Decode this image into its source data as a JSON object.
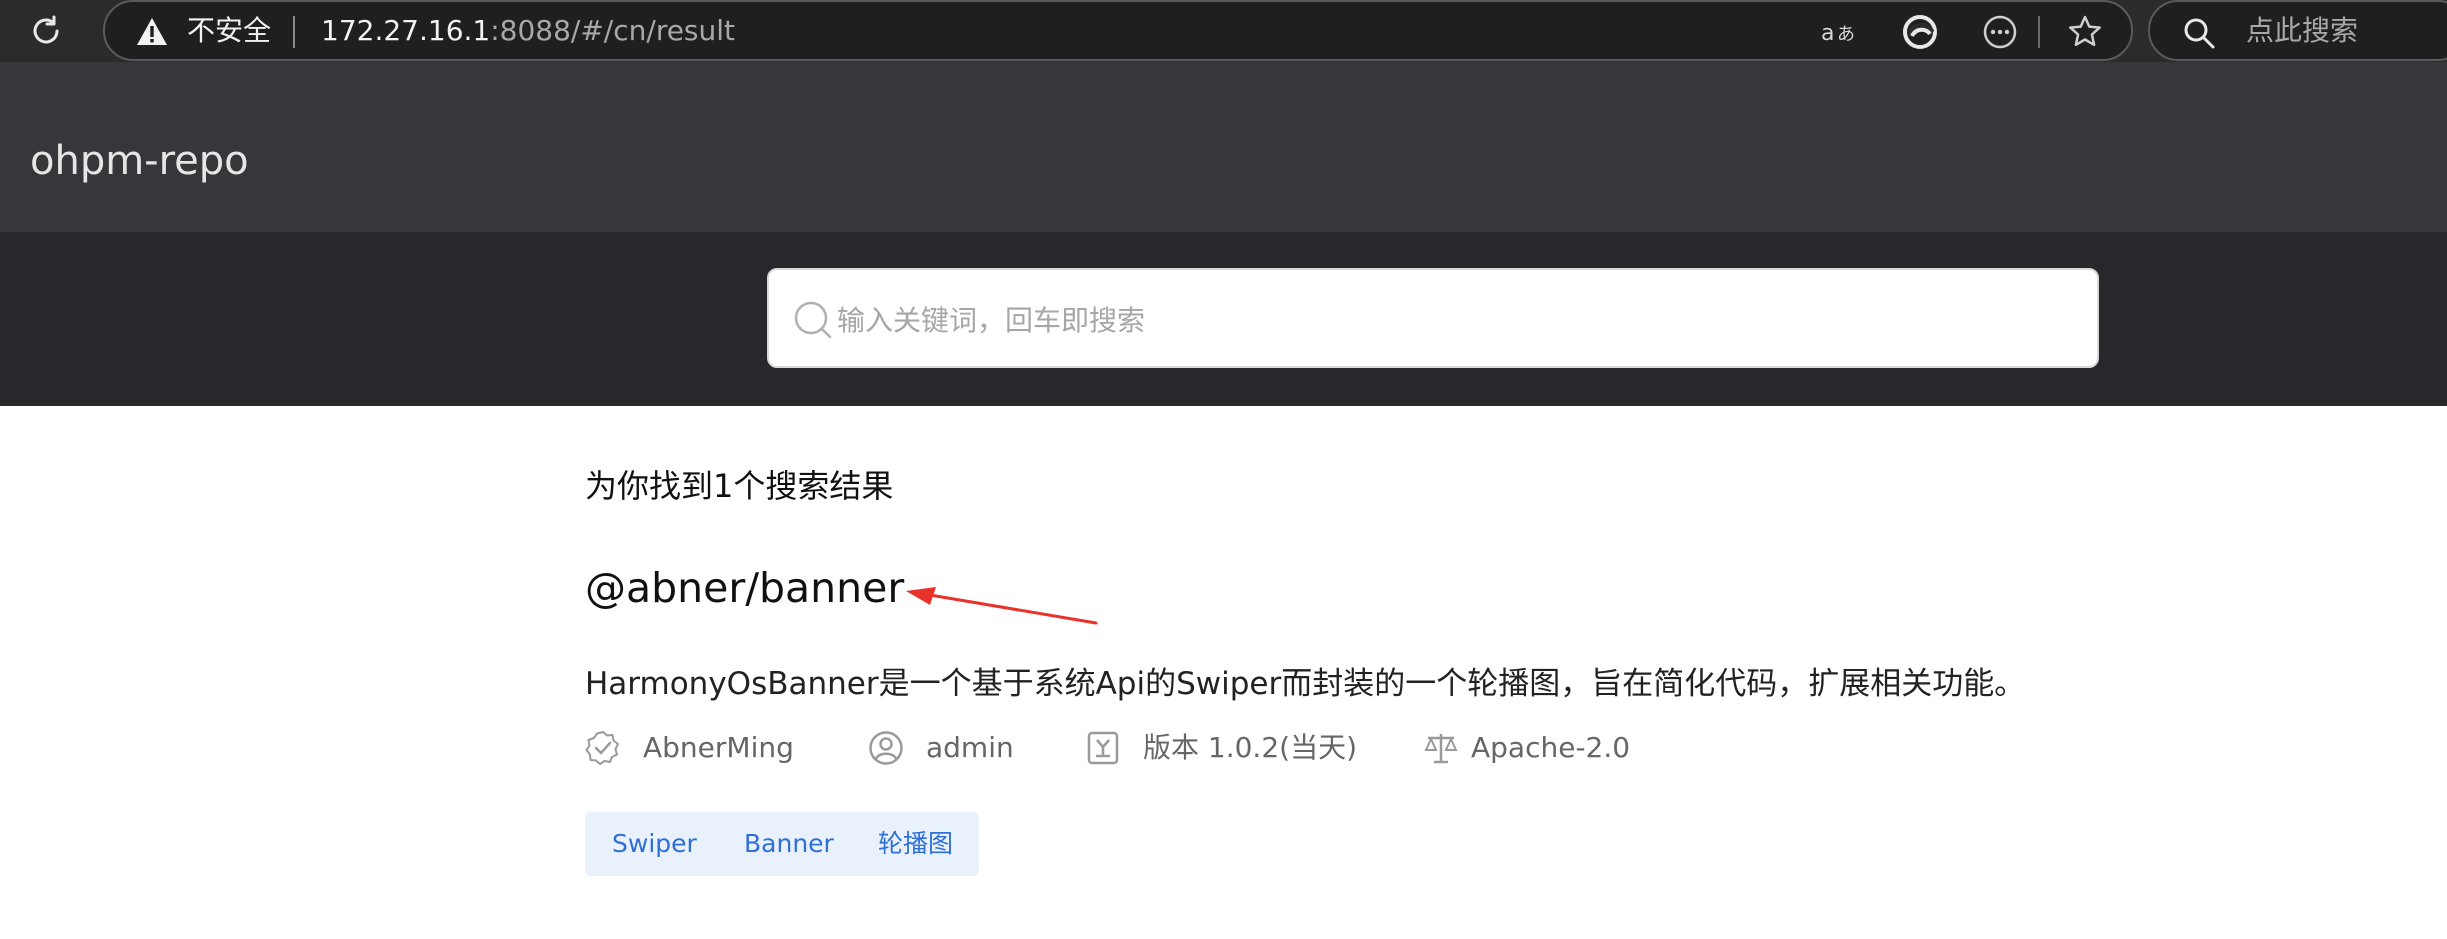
{
  "browser": {
    "security_label": "不安全",
    "url_host": "172.27.16.1",
    "url_rest": ":8088/#/cn/result",
    "search_placeholder": "点此搜索",
    "icons": {
      "reload": "reload-icon",
      "warning": "warning-triangle-icon",
      "read_aloud": "read-aloud-icon",
      "copilot": "edge-copilot-icon",
      "more": "more-options-icon",
      "favorite": "favorite-star-icon",
      "search": "search-icon"
    }
  },
  "header": {
    "logo": "ohpm-repo"
  },
  "search": {
    "placeholder": "输入关键词，回车即搜索",
    "value": ""
  },
  "results": {
    "summary": "为你找到1个搜索结果",
    "items": [
      {
        "name": "@abner/banner",
        "description": "HarmonyOsBanner是一个基于系统Api的Swiper而封装的一个轮播图，旨在简化代码，扩展相关功能。",
        "publisher": "AbnerMing",
        "owner": "admin",
        "version": "版本 1.0.2(当天)",
        "license": "Apache-2.0",
        "tags": [
          "Swiper",
          "Banner",
          "轮播图"
        ]
      }
    ]
  },
  "colors": {
    "browser_bar": "#2b2b2d",
    "header": "#35373b",
    "search_band": "#26282b",
    "tag_bg": "#e9f1fd",
    "tag_text": "#2f6fd6",
    "annotation_arrow": "#e8322a"
  }
}
